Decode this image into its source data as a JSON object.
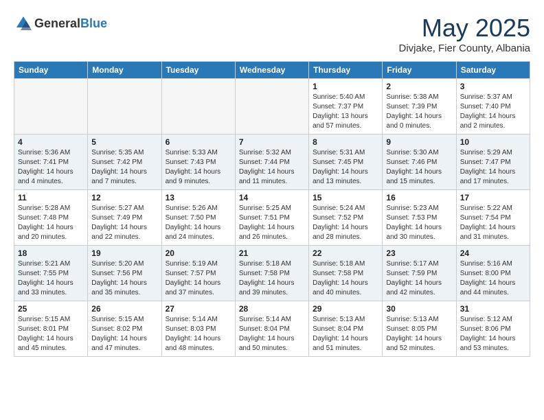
{
  "header": {
    "logo_general": "General",
    "logo_blue": "Blue",
    "month_title": "May 2025",
    "subtitle": "Divjake, Fier County, Albania"
  },
  "days_of_week": [
    "Sunday",
    "Monday",
    "Tuesday",
    "Wednesday",
    "Thursday",
    "Friday",
    "Saturday"
  ],
  "weeks": [
    [
      {
        "day": "",
        "sunrise": "",
        "sunset": "",
        "daylight": ""
      },
      {
        "day": "",
        "sunrise": "",
        "sunset": "",
        "daylight": ""
      },
      {
        "day": "",
        "sunrise": "",
        "sunset": "",
        "daylight": ""
      },
      {
        "day": "",
        "sunrise": "",
        "sunset": "",
        "daylight": ""
      },
      {
        "day": "1",
        "sunrise": "Sunrise: 5:40 AM",
        "sunset": "Sunset: 7:37 PM",
        "daylight": "Daylight: 13 hours and 57 minutes."
      },
      {
        "day": "2",
        "sunrise": "Sunrise: 5:38 AM",
        "sunset": "Sunset: 7:39 PM",
        "daylight": "Daylight: 14 hours and 0 minutes."
      },
      {
        "day": "3",
        "sunrise": "Sunrise: 5:37 AM",
        "sunset": "Sunset: 7:40 PM",
        "daylight": "Daylight: 14 hours and 2 minutes."
      }
    ],
    [
      {
        "day": "4",
        "sunrise": "Sunrise: 5:36 AM",
        "sunset": "Sunset: 7:41 PM",
        "daylight": "Daylight: 14 hours and 4 minutes."
      },
      {
        "day": "5",
        "sunrise": "Sunrise: 5:35 AM",
        "sunset": "Sunset: 7:42 PM",
        "daylight": "Daylight: 14 hours and 7 minutes."
      },
      {
        "day": "6",
        "sunrise": "Sunrise: 5:33 AM",
        "sunset": "Sunset: 7:43 PM",
        "daylight": "Daylight: 14 hours and 9 minutes."
      },
      {
        "day": "7",
        "sunrise": "Sunrise: 5:32 AM",
        "sunset": "Sunset: 7:44 PM",
        "daylight": "Daylight: 14 hours and 11 minutes."
      },
      {
        "day": "8",
        "sunrise": "Sunrise: 5:31 AM",
        "sunset": "Sunset: 7:45 PM",
        "daylight": "Daylight: 14 hours and 13 minutes."
      },
      {
        "day": "9",
        "sunrise": "Sunrise: 5:30 AM",
        "sunset": "Sunset: 7:46 PM",
        "daylight": "Daylight: 14 hours and 15 minutes."
      },
      {
        "day": "10",
        "sunrise": "Sunrise: 5:29 AM",
        "sunset": "Sunset: 7:47 PM",
        "daylight": "Daylight: 14 hours and 17 minutes."
      }
    ],
    [
      {
        "day": "11",
        "sunrise": "Sunrise: 5:28 AM",
        "sunset": "Sunset: 7:48 PM",
        "daylight": "Daylight: 14 hours and 20 minutes."
      },
      {
        "day": "12",
        "sunrise": "Sunrise: 5:27 AM",
        "sunset": "Sunset: 7:49 PM",
        "daylight": "Daylight: 14 hours and 22 minutes."
      },
      {
        "day": "13",
        "sunrise": "Sunrise: 5:26 AM",
        "sunset": "Sunset: 7:50 PM",
        "daylight": "Daylight: 14 hours and 24 minutes."
      },
      {
        "day": "14",
        "sunrise": "Sunrise: 5:25 AM",
        "sunset": "Sunset: 7:51 PM",
        "daylight": "Daylight: 14 hours and 26 minutes."
      },
      {
        "day": "15",
        "sunrise": "Sunrise: 5:24 AM",
        "sunset": "Sunset: 7:52 PM",
        "daylight": "Daylight: 14 hours and 28 minutes."
      },
      {
        "day": "16",
        "sunrise": "Sunrise: 5:23 AM",
        "sunset": "Sunset: 7:53 PM",
        "daylight": "Daylight: 14 hours and 30 minutes."
      },
      {
        "day": "17",
        "sunrise": "Sunrise: 5:22 AM",
        "sunset": "Sunset: 7:54 PM",
        "daylight": "Daylight: 14 hours and 31 minutes."
      }
    ],
    [
      {
        "day": "18",
        "sunrise": "Sunrise: 5:21 AM",
        "sunset": "Sunset: 7:55 PM",
        "daylight": "Daylight: 14 hours and 33 minutes."
      },
      {
        "day": "19",
        "sunrise": "Sunrise: 5:20 AM",
        "sunset": "Sunset: 7:56 PM",
        "daylight": "Daylight: 14 hours and 35 minutes."
      },
      {
        "day": "20",
        "sunrise": "Sunrise: 5:19 AM",
        "sunset": "Sunset: 7:57 PM",
        "daylight": "Daylight: 14 hours and 37 minutes."
      },
      {
        "day": "21",
        "sunrise": "Sunrise: 5:18 AM",
        "sunset": "Sunset: 7:58 PM",
        "daylight": "Daylight: 14 hours and 39 minutes."
      },
      {
        "day": "22",
        "sunrise": "Sunrise: 5:18 AM",
        "sunset": "Sunset: 7:58 PM",
        "daylight": "Daylight: 14 hours and 40 minutes."
      },
      {
        "day": "23",
        "sunrise": "Sunrise: 5:17 AM",
        "sunset": "Sunset: 7:59 PM",
        "daylight": "Daylight: 14 hours and 42 minutes."
      },
      {
        "day": "24",
        "sunrise": "Sunrise: 5:16 AM",
        "sunset": "Sunset: 8:00 PM",
        "daylight": "Daylight: 14 hours and 44 minutes."
      }
    ],
    [
      {
        "day": "25",
        "sunrise": "Sunrise: 5:15 AM",
        "sunset": "Sunset: 8:01 PM",
        "daylight": "Daylight: 14 hours and 45 minutes."
      },
      {
        "day": "26",
        "sunrise": "Sunrise: 5:15 AM",
        "sunset": "Sunset: 8:02 PM",
        "daylight": "Daylight: 14 hours and 47 minutes."
      },
      {
        "day": "27",
        "sunrise": "Sunrise: 5:14 AM",
        "sunset": "Sunset: 8:03 PM",
        "daylight": "Daylight: 14 hours and 48 minutes."
      },
      {
        "day": "28",
        "sunrise": "Sunrise: 5:14 AM",
        "sunset": "Sunset: 8:04 PM",
        "daylight": "Daylight: 14 hours and 50 minutes."
      },
      {
        "day": "29",
        "sunrise": "Sunrise: 5:13 AM",
        "sunset": "Sunset: 8:04 PM",
        "daylight": "Daylight: 14 hours and 51 minutes."
      },
      {
        "day": "30",
        "sunrise": "Sunrise: 5:13 AM",
        "sunset": "Sunset: 8:05 PM",
        "daylight": "Daylight: 14 hours and 52 minutes."
      },
      {
        "day": "31",
        "sunrise": "Sunrise: 5:12 AM",
        "sunset": "Sunset: 8:06 PM",
        "daylight": "Daylight: 14 hours and 53 minutes."
      }
    ]
  ]
}
